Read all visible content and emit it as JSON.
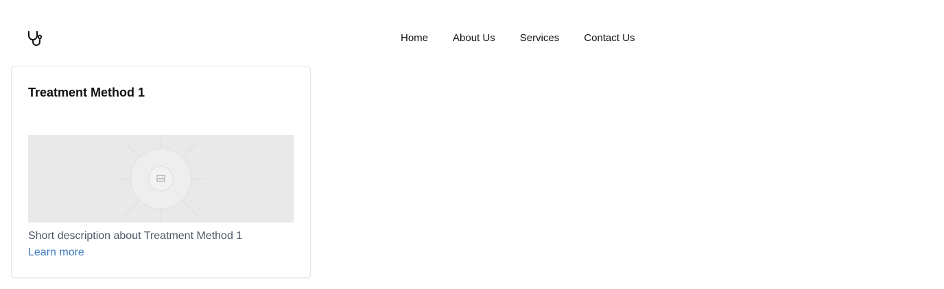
{
  "header": {
    "logo_icon": "stethoscope-icon",
    "nav": [
      {
        "label": "Home"
      },
      {
        "label": "About Us"
      },
      {
        "label": "Services"
      },
      {
        "label": "Contact Us"
      }
    ]
  },
  "card": {
    "title": "Treatment Method 1",
    "image_icon": "image-placeholder-icon",
    "description": "Short description about Treatment Method 1",
    "link_label": "Learn more",
    "link_color": "#3b7bbf"
  }
}
